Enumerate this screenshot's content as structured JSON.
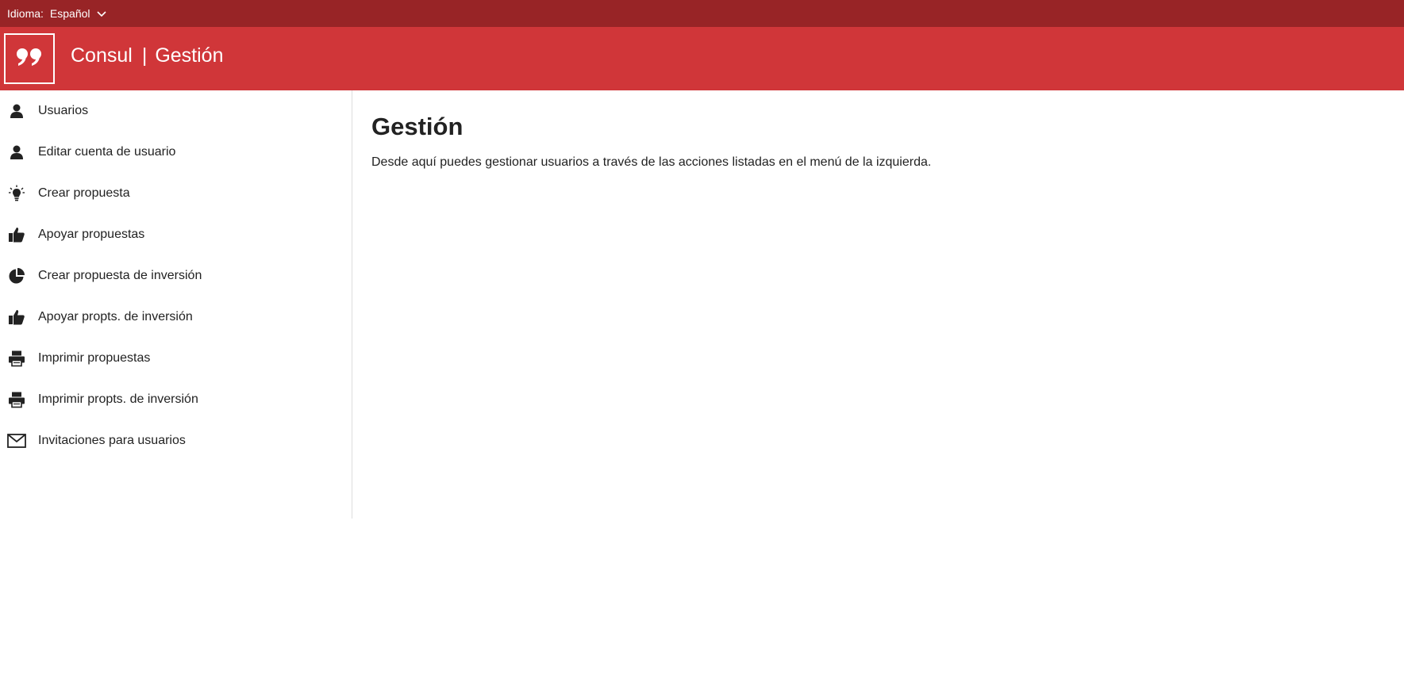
{
  "topbar": {
    "language_label": "Idioma:",
    "language_value": "Español",
    "chevron_icon": "chevron-down-icon"
  },
  "header": {
    "logo_icon": "quote-icon",
    "app_name": "Consul",
    "separator": "|",
    "section": "Gestión"
  },
  "sidebar": {
    "items": [
      {
        "label": "Usuarios",
        "icon": "user-icon"
      },
      {
        "label": "Editar cuenta de usuario",
        "icon": "user-icon"
      },
      {
        "label": "Crear propuesta",
        "icon": "lightbulb-icon"
      },
      {
        "label": "Apoyar propuestas",
        "icon": "thumbs-up-icon"
      },
      {
        "label": "Crear propuesta de inversión",
        "icon": "pie-chart-icon"
      },
      {
        "label": "Apoyar propts. de inversión",
        "icon": "thumbs-up-icon"
      },
      {
        "label": "Imprimir propuestas",
        "icon": "printer-icon"
      },
      {
        "label": "Imprimir propts. de inversión",
        "icon": "printer-icon"
      },
      {
        "label": "Invitaciones para usuarios",
        "icon": "envelope-icon"
      }
    ]
  },
  "main": {
    "title": "Gestión",
    "description": "Desde aquí puedes gestionar usuarios a través de las acciones listadas en el menú de la izquierda."
  },
  "colors": {
    "topbar_bg": "#982426",
    "header_bg": "#d03639",
    "text": "#222222"
  }
}
